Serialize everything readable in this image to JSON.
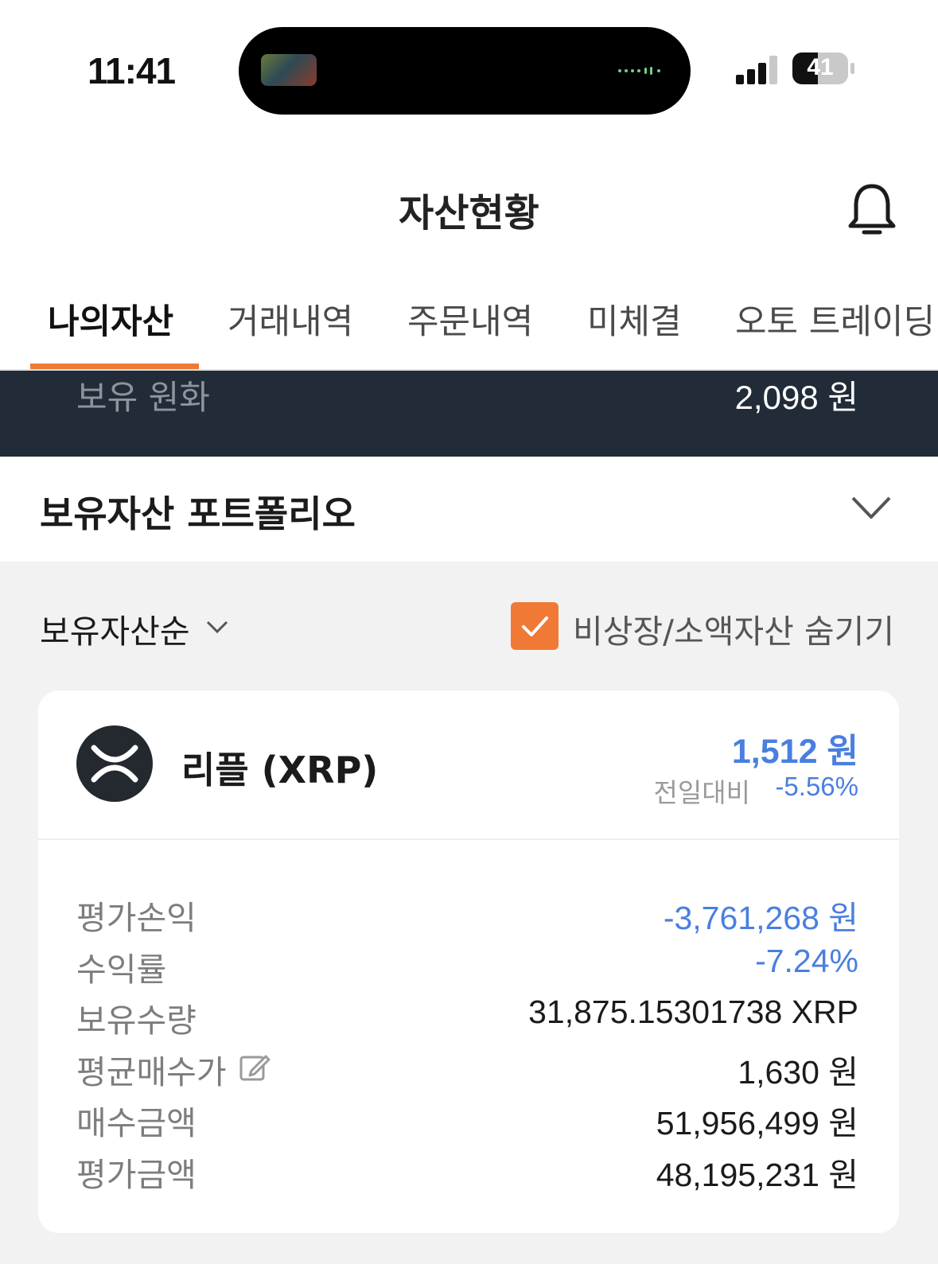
{
  "status_bar": {
    "time": "11:41",
    "battery": "41"
  },
  "header": {
    "title": "자산현황"
  },
  "tabs": [
    {
      "label": "나의자산",
      "active": true
    },
    {
      "label": "거래내역"
    },
    {
      "label": "주문내역"
    },
    {
      "label": "미체결"
    },
    {
      "label": "오토 트레이딩"
    }
  ],
  "krw": {
    "label": "보유 원화",
    "value": "2,098 원"
  },
  "portfolio": {
    "title": "보유자산 포트폴리오"
  },
  "filters": {
    "sort_label": "보유자산순",
    "hide_label": "비상장/소액자산 숨기기",
    "hide_checked": true
  },
  "asset": {
    "name": "리플 (XRP)",
    "price": "1,512 원",
    "change_label": "전일대비",
    "change_value": "-5.56%",
    "rows": [
      {
        "label": "평가손익",
        "value": "-3,761,268 원"
      },
      {
        "label": "수익률",
        "value": "-7.24%"
      },
      {
        "label": "보유수량",
        "value": "31,875.15301738 XRP"
      },
      {
        "label": "평균매수가",
        "value": "1,630 원"
      },
      {
        "label": "매수금액",
        "value": "51,956,499 원"
      },
      {
        "label": "평가금액",
        "value": "48,195,231 원"
      }
    ]
  },
  "colors": {
    "accent": "#f07a35",
    "negative": "#4a7fe0",
    "dark_strip": "#222b38"
  },
  "icons": [
    "bell-icon",
    "chevron-down-icon",
    "check-icon",
    "xrp-logo-icon",
    "edit-icon",
    "signal-icon",
    "battery-icon"
  ]
}
